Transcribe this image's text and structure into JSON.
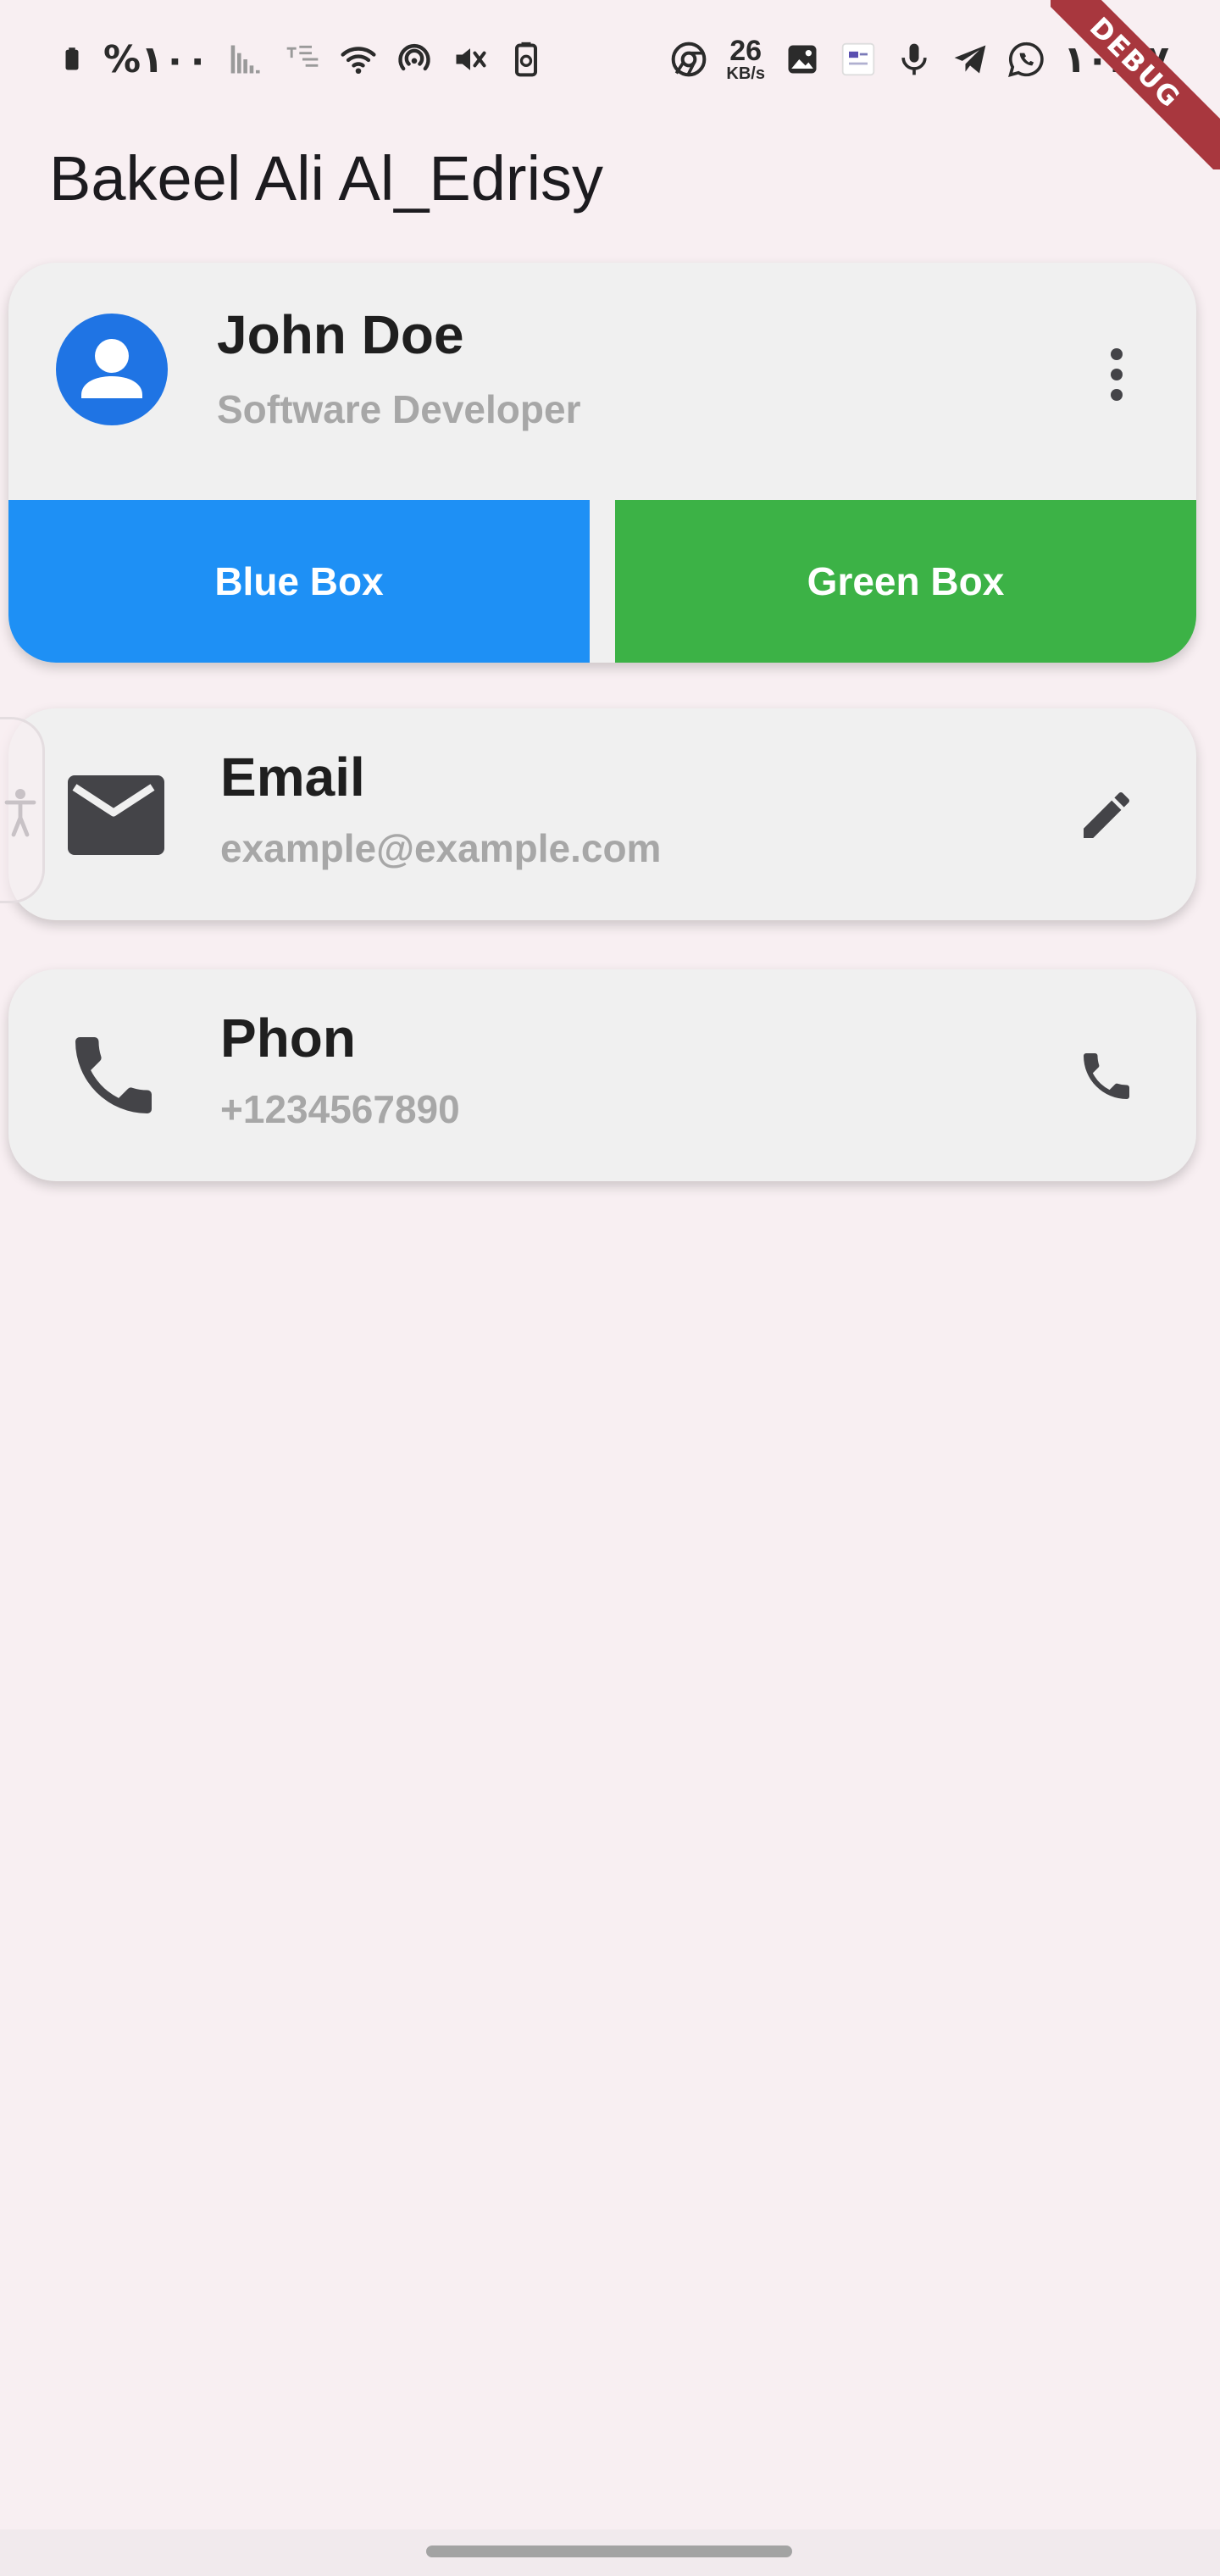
{
  "status_bar": {
    "battery_text": "%١٠٠",
    "time": "١٠:١٧",
    "speed_value": "26",
    "speed_unit": "KB/s",
    "left_icons": [
      "battery-icon",
      "signal-bars-icon",
      "network-type-icon",
      "wifi-icon",
      "hotspot-icon",
      "mute-icon",
      "battery-saver-icon"
    ],
    "right_icons": [
      "chrome-icon",
      "gallery-icon",
      "app-notification-icon",
      "microphone-icon",
      "telegram-icon",
      "whatsapp-icon"
    ]
  },
  "debug_banner": {
    "label": "DEBUG",
    "color": "#a8373e"
  },
  "app_bar": {
    "title": "Bakeel Ali Al_Edrisy"
  },
  "profile_card": {
    "name": "John Doe",
    "role": "Software Developer",
    "avatar_icon": "person-icon",
    "menu_icon": "more-vert-icon",
    "boxes": [
      {
        "label": "Blue Box",
        "color": "#1e90f5"
      },
      {
        "label": "Green Box",
        "color": "#3cb246"
      }
    ]
  },
  "email_tile": {
    "title": "Email",
    "subtitle": "example@example.com",
    "leading_icon": "mail-icon",
    "trailing_icon": "edit-icon"
  },
  "phone_tile": {
    "title": "Phon",
    "subtitle": "+1234567890",
    "leading_icon": "phone-icon",
    "trailing_icon": "phone-icon"
  },
  "colors": {
    "background": "#f8eff2",
    "card": "#f0f0f0",
    "avatar": "#1f74e4",
    "subtitle": "#a7a7a7",
    "icon": "#444448"
  }
}
